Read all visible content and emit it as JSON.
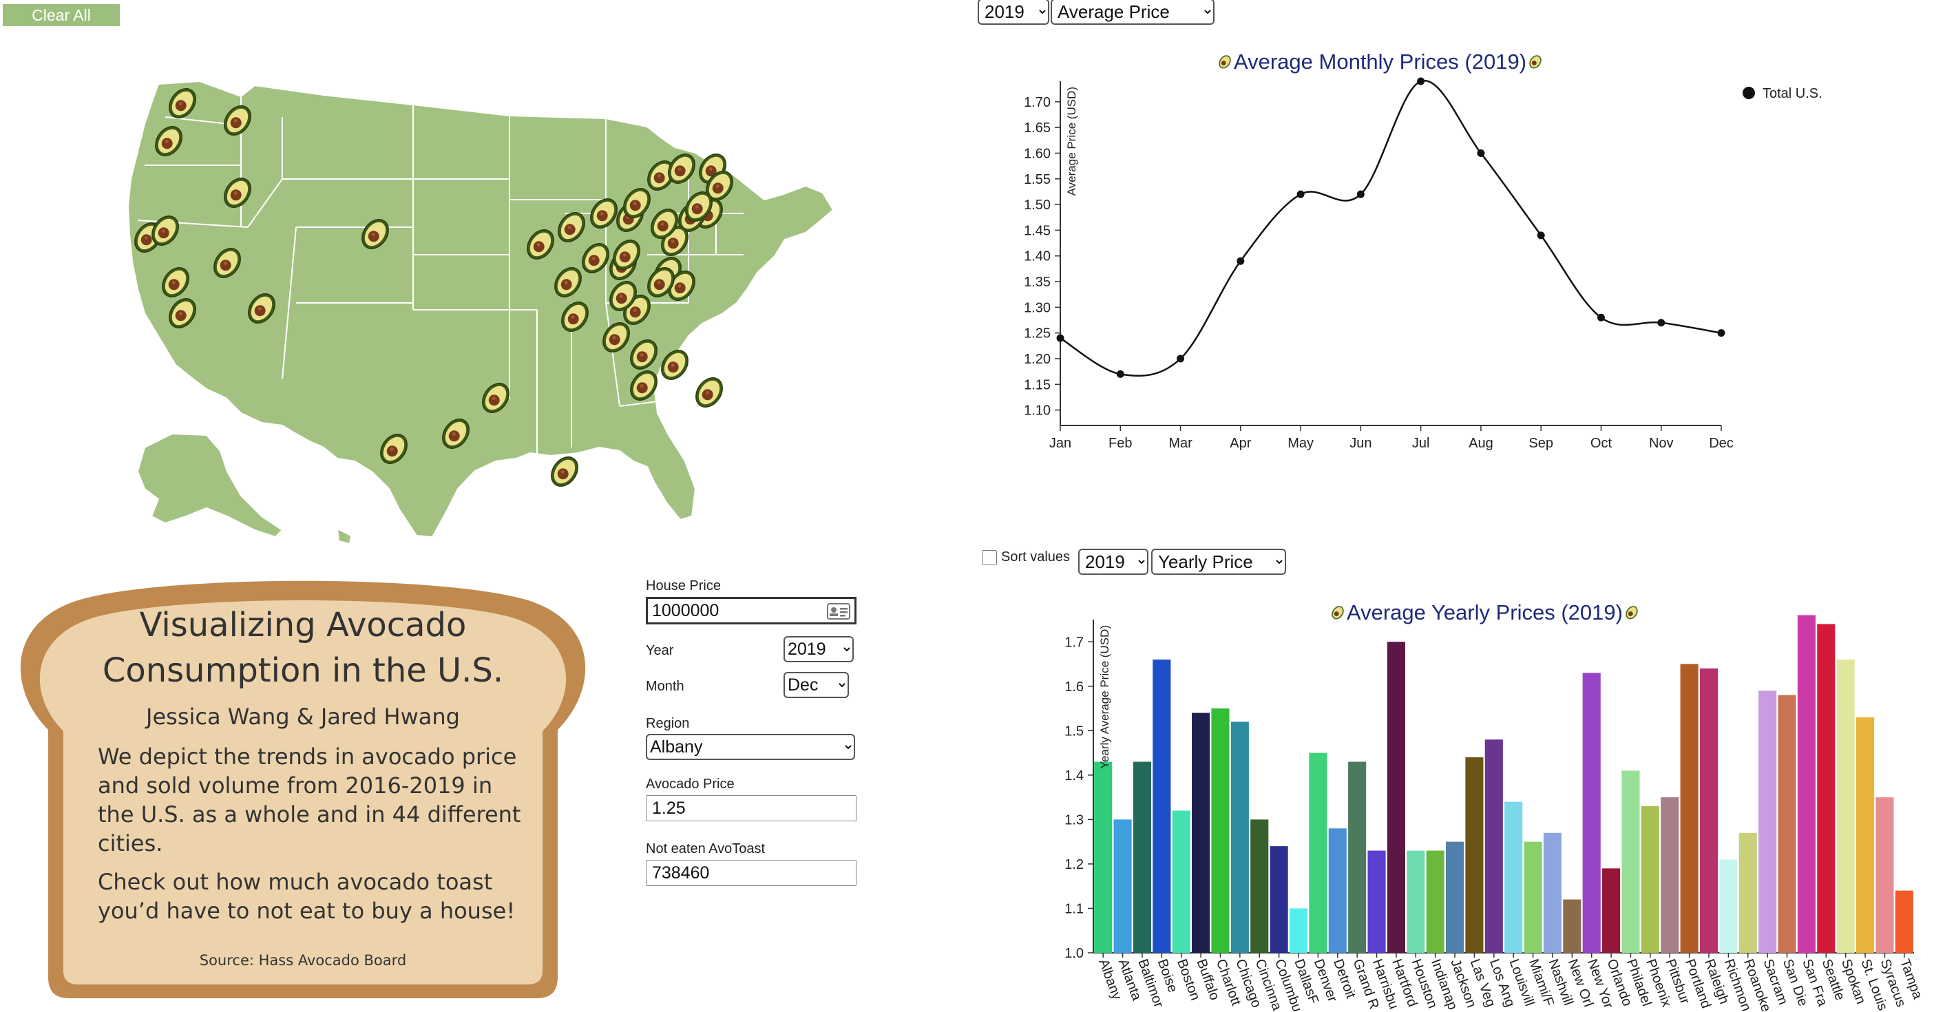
{
  "controls": {
    "clear_label": "Clear All",
    "top_year": "2019",
    "top_metric": "Average Price",
    "sort_label": "Sort values",
    "bar_year": "2019",
    "bar_metric": "Yearly Price"
  },
  "toast": {
    "title_line1": "Visualizing Avocado",
    "title_line2": "Consumption in the U.S.",
    "authors": "Jessica Wang & Jared Hwang",
    "para1": "We depict the trends in avocado price and sold volume from 2016-2019 in the U.S. as a whole and in 44 different cities.",
    "para2": "Check out how much avocado toast you’d have to not eat to buy a house!",
    "source": "Source: Hass Avocado Board"
  },
  "form": {
    "house_price_label": "House Price",
    "house_price_value": "1000000",
    "year_label": "Year",
    "year_value": "2019",
    "month_label": "Month",
    "month_value": "Dec",
    "region_label": "Region",
    "region_value": "Albany",
    "avocado_price_label": "Avocado Price",
    "avocado_price_value": "1.25",
    "not_eaten_label": "Not eaten AvoToast",
    "not_eaten_value": "738460"
  },
  "icons": {
    "avocado": "avocado-icon",
    "id_card": "id-card-icon",
    "dropdown": "chevron-down-icon"
  },
  "colors": {
    "map_fill": "#a3c281",
    "map_stroke": "#ffffff",
    "toast_crust": "#c08a4e",
    "toast_inner": "#ecd3ac",
    "line": "#111111",
    "axis": "#333333",
    "title_text": "#1e2a78"
  },
  "chart_data": [
    {
      "type": "line",
      "title": "Average Monthly Prices (2019)",
      "ylabel": "Average Price (USD)",
      "xlabel": "",
      "legend": "top-right",
      "ylim": [
        1.07,
        1.74
      ],
      "yticks": [
        "1.10",
        "1.15",
        "1.20",
        "1.25",
        "1.30",
        "1.35",
        "1.40",
        "1.45",
        "1.50",
        "1.55",
        "1.60",
        "1.65",
        "1.70"
      ],
      "categories": [
        "Jan",
        "Feb",
        "Mar",
        "Apr",
        "May",
        "Jun",
        "Jul",
        "Aug",
        "Sep",
        "Oct",
        "Nov",
        "Dec"
      ],
      "series": [
        {
          "name": "Total U.S.",
          "values": [
            1.24,
            1.17,
            1.2,
            1.39,
            1.52,
            1.52,
            1.74,
            1.6,
            1.44,
            1.28,
            1.27,
            1.25
          ]
        }
      ]
    },
    {
      "type": "bar",
      "title": "Average Yearly Prices (2019)",
      "ylabel": "Yearly Average Price (USD)",
      "xlabel": "",
      "ylim": [
        1.0,
        1.75
      ],
      "yticks": [
        "1.0",
        "1.1",
        "1.2",
        "1.3",
        "1.4",
        "1.5",
        "1.6",
        "1.7"
      ],
      "categories": [
        "Albany",
        "Atlanta",
        "Baltimor",
        "Boise",
        "Boston",
        "Buffalo",
        "Charlott",
        "Chicago",
        "Cincinna",
        "Columbu",
        "DallasF",
        "Denver",
        "Detroit",
        "Grand R",
        "Harrisbu",
        "Hartford",
        "Houston",
        "Indianap",
        "Jackson",
        "Las Veg",
        "Los Ang",
        "Louisvill",
        "Miami/F",
        "Nashvill",
        "New Orl",
        "New Yor",
        "Orlando",
        "Philadel",
        "Phoenix",
        "Pittsbur",
        "Portland",
        "Raleigh",
        "Richmon",
        "Roanoke",
        "Sacram",
        "San Die",
        "San Fra",
        "Seattle",
        "Spokan",
        "St. Louis",
        "Syracus",
        "Tampa"
      ],
      "values": [
        1.43,
        1.3,
        1.43,
        1.66,
        1.32,
        1.54,
        1.55,
        1.52,
        1.3,
        1.24,
        1.1,
        1.45,
        1.28,
        1.43,
        1.23,
        1.7,
        1.23,
        1.23,
        1.25,
        1.44,
        1.48,
        1.34,
        1.25,
        1.27,
        1.12,
        1.63,
        1.19,
        1.41,
        1.33,
        1.35,
        1.65,
        1.64,
        1.21,
        1.27,
        1.59,
        1.58,
        1.76,
        1.74,
        1.66,
        1.53,
        1.35,
        1.14
      ],
      "colors": [
        "#2fcc7a",
        "#3f9ede",
        "#236a5a",
        "#1e4ec8",
        "#45e0b0",
        "#1f1f4e",
        "#36bd36",
        "#2e8ba0",
        "#37602b",
        "#2b2f8f",
        "#55eef0",
        "#3fd07a",
        "#4c8fd6",
        "#4d7a5c",
        "#5b3fcf",
        "#5c1744",
        "#6fdcb0",
        "#6cb83f",
        "#4f7faa",
        "#6b5416",
        "#6b3490",
        "#7ad8e8",
        "#8ad06a",
        "#8ea6df",
        "#8a6c4a",
        "#9645c8",
        "#96163a",
        "#98e098",
        "#a8c052",
        "#a87e88",
        "#b05c22",
        "#b8306e",
        "#c8f4f0",
        "#c8d07a",
        "#c89ce0",
        "#c87452",
        "#cc3aa8",
        "#d41a3a",
        "#e0e69c",
        "#e8b43c",
        "#e88c94",
        "#f05a26"
      ]
    }
  ]
}
